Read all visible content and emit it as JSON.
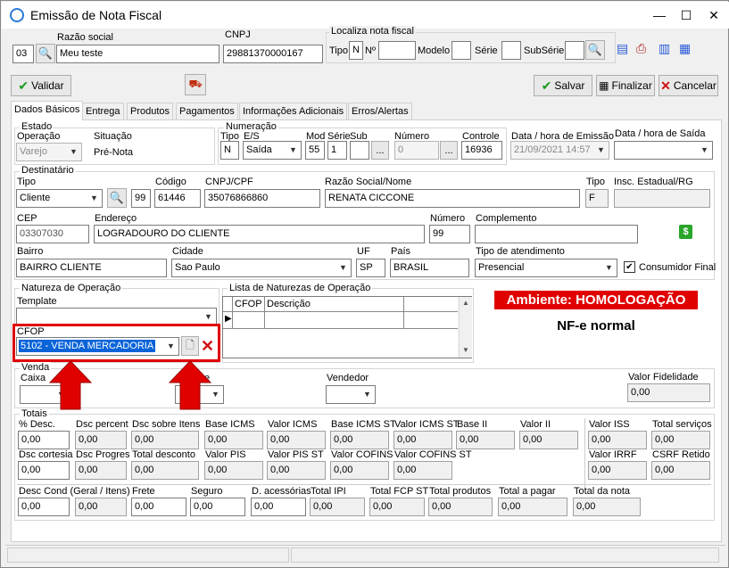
{
  "window": {
    "title": "Emissão de Nota Fiscal",
    "min": "—",
    "max": "☐",
    "close": "✕"
  },
  "header": {
    "razao_label": "Razão social",
    "cnpj_label": "CNPJ",
    "localiza_label": "Localiza nota fiscal",
    "code": "03",
    "razao": "Meu teste",
    "cnpj": "29881370000167",
    "tipo_label": "Tipo",
    "tipo_value": "N",
    "numero_label": "Nº",
    "modelo_label": "Modelo",
    "serie_label": "Série",
    "subserie_label": "SubSérie"
  },
  "toolbar": {
    "validar": "Validar",
    "salvar": "Salvar",
    "finalizar": "Finalizar",
    "cancelar": "Cancelar"
  },
  "tabs": [
    "Dados Básicos",
    "Entrega",
    "Produtos",
    "Pagamentos",
    "Informações Adicionais",
    "Erros/Alertas"
  ],
  "estado": {
    "group": "Estado",
    "operacao_label": "Operação",
    "operacao": "Varejo",
    "situacao_label": "Situação",
    "situacao": "Pré-Nota"
  },
  "numeracao": {
    "group": "Numeração",
    "tipo_label": "Tipo",
    "tipo": "N",
    "es_label": "E/S",
    "es": "Saída",
    "mod_label": "Mod",
    "mod": "55",
    "serie_label": "Série",
    "serie": "1",
    "sub_label": "Sub",
    "numero_label": "Número",
    "numero": "0",
    "controle_label": "Controle",
    "controle": "16936",
    "ellipsis": "..."
  },
  "datas": {
    "emissao_label": "Data / hora de Emissão",
    "emissao": "21/09/2021 14:57",
    "saida_label": "Data / hora de Saída"
  },
  "destinatario": {
    "group": "Destinatário",
    "tipo_label": "Tipo",
    "tipo": "Cliente",
    "codigo_label": "Código",
    "prefix": "99",
    "codigo": "61446",
    "cnpj_label": "CNPJ/CPF",
    "cnpj": "35076866860",
    "razao_label": "Razão Social/Nome",
    "razao": "RENATA CICCONE",
    "tipo2_label": "Tipo",
    "tipo2": "F",
    "ie_label": "Insc. Estadual/RG",
    "cep_label": "CEP",
    "cep": "03307030",
    "endereco_label": "Endereço",
    "endereco": "LOGRADOURO DO CLIENTE",
    "numero_label": "Número",
    "numero": "99",
    "complemento_label": "Complemento",
    "bairro_label": "Bairro",
    "bairro": "BAIRRO CLIENTE",
    "cidade_label": "Cidade",
    "cidade": "Sao Paulo",
    "uf_label": "UF",
    "uf": "SP",
    "pais_label": "País",
    "pais": "BRASIL",
    "atendimento_label": "Tipo de atendimento",
    "atendimento": "Presencial",
    "consumidor_label": "Consumidor Final"
  },
  "natureza": {
    "group": "Natureza de Operação",
    "template_label": "Template",
    "cfop_label": "CFOP",
    "cfop": "5102  - VENDA MERCADORIA",
    "lista_label": "Lista de Naturezas de Operação",
    "col_cfop": "CFOP",
    "col_desc": "Descrição"
  },
  "ambiente": {
    "text": "Ambiente: HOMOLOGAÇÃO",
    "nfe": "NF-e normal",
    "color": "#e00000"
  },
  "venda": {
    "group": "Venda",
    "caixa_label": "Caixa",
    "vendedor_label": "Vendedor",
    "fidelidade_label": "Valor Fidelidade",
    "fidelidade": "0,00",
    "partial_label": "e"
  },
  "totais": {
    "group": "Totais",
    "row1": [
      {
        "l": "% Desc.",
        "v": "0,00"
      },
      {
        "l": "Dsc percent",
        "v": "0,00"
      },
      {
        "l": "Dsc sobre Itens",
        "v": "0,00"
      },
      {
        "l": "Base ICMS",
        "v": "0,00"
      },
      {
        "l": "Valor ICMS",
        "v": "0,00"
      },
      {
        "l": "Base ICMS ST",
        "v": "0,00"
      },
      {
        "l": "Valor ICMS ST",
        "v": "0,00"
      },
      {
        "l": "Base II",
        "v": "0,00"
      },
      {
        "l": "Valor II",
        "v": "0,00"
      },
      {
        "l": "Valor ISS",
        "v": "0,00"
      },
      {
        "l": "Total serviços",
        "v": "0,00"
      }
    ],
    "row2": [
      {
        "l": "Dsc cortesia",
        "v": "0,00"
      },
      {
        "l": "Dsc Progres",
        "v": "0,00"
      },
      {
        "l": "Total desconto",
        "v": "0,00"
      },
      {
        "l": "Valor PIS",
        "v": "0,00"
      },
      {
        "l": "Valor PIS ST",
        "v": "0,00"
      },
      {
        "l": "Valor COFINS",
        "v": "0,00"
      },
      {
        "l": "Valor COFINS ST",
        "v": "0,00"
      },
      {
        "l": "Valor IRRF",
        "v": "0,00"
      },
      {
        "l": "CSRF Retido",
        "v": "0,00"
      }
    ],
    "row3": [
      {
        "l": "Desc Cond (Geral / Itens)",
        "v": "0,00"
      },
      {
        "l": "",
        "v": "0,00"
      },
      {
        "l": "Frete",
        "v": "0,00"
      },
      {
        "l": "Seguro",
        "v": "0,00"
      },
      {
        "l": "D. acessórias",
        "v": "0,00"
      },
      {
        "l": "Total IPI",
        "v": "0,00"
      },
      {
        "l": "Total FCP ST",
        "v": "0,00"
      },
      {
        "l": "Total produtos",
        "v": "0,00"
      },
      {
        "l": "Total a pagar",
        "v": "0,00"
      },
      {
        "l": "Total da nota",
        "v": "0,00"
      }
    ]
  },
  "colors": {
    "highlight_box": "#e00000",
    "arrow": "#e00000",
    "selection": "#0a64d8"
  }
}
